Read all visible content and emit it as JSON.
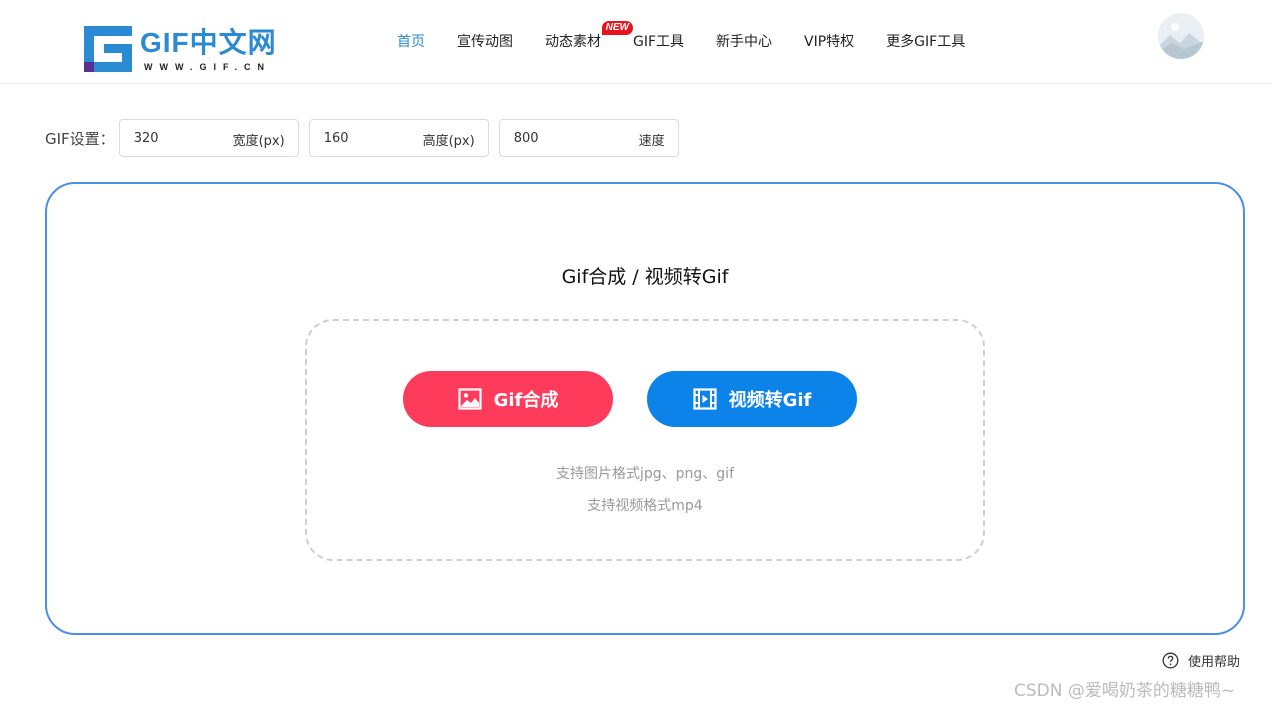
{
  "brand": {
    "name": "GIF中文网",
    "domain": "WWW.GIF.CN",
    "color": "#2a8ad3"
  },
  "nav": {
    "items": [
      {
        "label": "首页",
        "active": true
      },
      {
        "label": "宣传动图"
      },
      {
        "label": "动态素材",
        "badge": "NEW"
      },
      {
        "label": "GIF工具"
      },
      {
        "label": "新手中心"
      },
      {
        "label": "VIP特权"
      },
      {
        "label": "更多GIF工具"
      }
    ]
  },
  "settings": {
    "label": "GIF设置：",
    "width": {
      "value": "320",
      "unit": "宽度(px)"
    },
    "height": {
      "value": "160",
      "unit": "高度(px)"
    },
    "speed": {
      "value": "800",
      "unit": "速度"
    }
  },
  "main": {
    "title": "Gif合成 / 视频转Gif",
    "compose_button": "Gif合成",
    "video_button": "视频转Gif",
    "hint_images": "支持图片格式jpg、png、gif",
    "hint_video": "支持视频格式mp4"
  },
  "help": {
    "label": "使用帮助"
  },
  "watermark": "CSDN @爱喝奶茶的糖糖鸭~",
  "colors": {
    "accent": "#2a8ad3",
    "panel_border": "#4a8fe8",
    "compose_button": "#ff3b5c",
    "video_button": "#0c83e8",
    "badge": "#e8131c"
  },
  "icons": {
    "logo": "gif-logo-icon",
    "compose": "image-icon",
    "video": "film-icon",
    "help": "question-circle-icon",
    "avatar": "avatar-image"
  }
}
